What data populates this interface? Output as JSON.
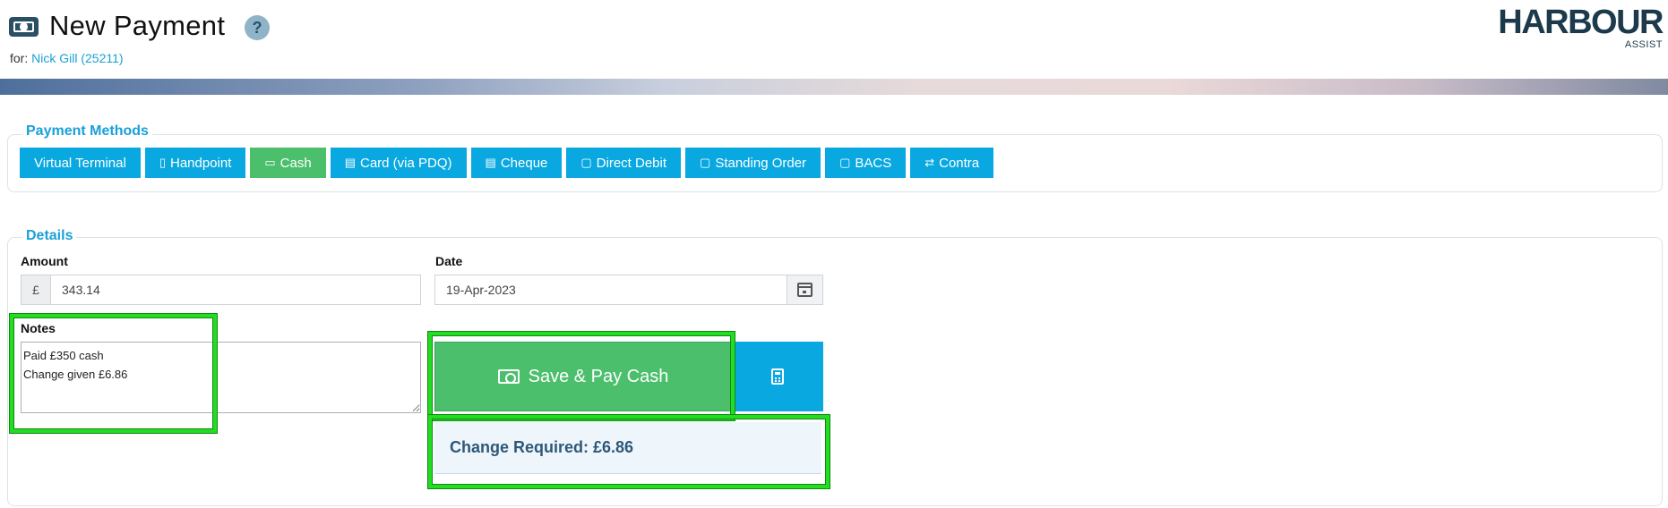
{
  "header": {
    "title": "New Payment",
    "help_label": "?",
    "for_prefix": "for:",
    "customer_link": "Nick Gill (25211)",
    "logo_text": "HARBOUR",
    "logo_sub": "ASSIST"
  },
  "payment_methods": {
    "legend": "Payment Methods",
    "items": [
      {
        "label": "Virtual Terminal",
        "icon": "none",
        "active": false
      },
      {
        "label": "Handpoint",
        "icon": "calculator-icon",
        "active": false
      },
      {
        "label": "Cash",
        "icon": "cash-icon",
        "active": true
      },
      {
        "label": "Card (via PDQ)",
        "icon": "card-icon",
        "active": false
      },
      {
        "label": "Cheque",
        "icon": "cheque-icon",
        "active": false
      },
      {
        "label": "Direct Debit",
        "icon": "calendar-icon",
        "active": false
      },
      {
        "label": "Standing Order",
        "icon": "calendar-icon",
        "active": false
      },
      {
        "label": "BACS",
        "icon": "calendar-icon",
        "active": false
      },
      {
        "label": "Contra",
        "icon": "arrows-icon",
        "active": false
      }
    ]
  },
  "details": {
    "legend": "Details",
    "amount_label": "Amount",
    "currency_symbol": "£",
    "amount_value": "343.14",
    "date_label": "Date",
    "date_value": "19-Apr-2023",
    "notes_label": "Notes",
    "notes_value": "Paid £350 cash\nChange given £6.86",
    "save_button": "Save & Pay Cash",
    "change_required": "Change Required: £6.86"
  },
  "colors": {
    "accent_blue": "#09a8e0",
    "active_green": "#4bbf6b",
    "highlight_green": "#22dd22"
  }
}
